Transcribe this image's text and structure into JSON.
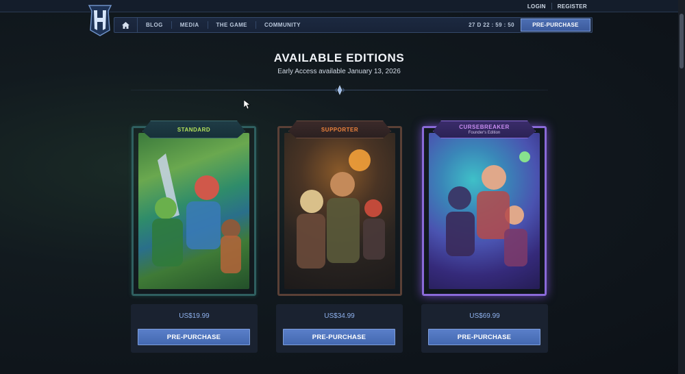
{
  "account": {
    "login": "LOGIN",
    "register": "REGISTER"
  },
  "nav": {
    "items": [
      {
        "label": "BLOG"
      },
      {
        "label": "MEDIA"
      },
      {
        "label": "THE GAME"
      },
      {
        "label": "COMMUNITY"
      }
    ],
    "countdown": "27 D 22 : 59 : 50",
    "cta_label": "PRE-PURCHASE"
  },
  "hero": {
    "title": "AVAILABLE EDITIONS",
    "subtitle": "Early Access available January 13, 2026"
  },
  "editions": [
    {
      "name": "STANDARD",
      "subtitle": "",
      "price": "US$19.99",
      "button": "PRE-PURCHASE",
      "accent": "#b5e35a"
    },
    {
      "name": "SUPPORTER",
      "subtitle": "",
      "price": "US$34.99",
      "button": "PRE-PURCHASE",
      "accent": "#f0843c"
    },
    {
      "name": "CURSEBREAKER",
      "subtitle": "Founder's Edition",
      "price": "US$69.99",
      "button": "PRE-PURCHASE",
      "accent": "#c98df2"
    }
  ],
  "colors": {
    "primary_button": "#4d6fb3",
    "price_text": "#8fb2ee",
    "background": "#0f151b"
  }
}
